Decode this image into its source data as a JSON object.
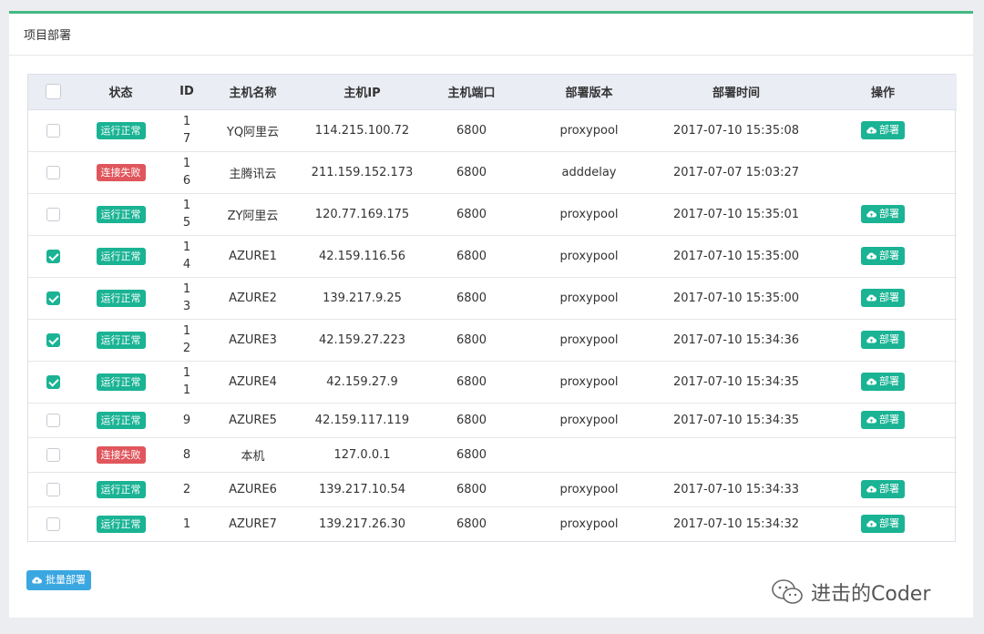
{
  "panel": {
    "title": "项目部署"
  },
  "table": {
    "headers": {
      "status": "状态",
      "id": "ID",
      "host_name": "主机名称",
      "host_ip": "主机IP",
      "host_port": "主机端口",
      "version": "部署版本",
      "time": "部署时间",
      "action": "操作"
    },
    "rows": [
      {
        "checked": false,
        "status": "运行正常",
        "status_type": "ok",
        "id_lines": [
          "1",
          "7"
        ],
        "name": "YQ阿里云",
        "ip": "114.215.100.72",
        "port": "6800",
        "version": "proxypool",
        "time": "2017-07-10 15:35:08",
        "action": "部署",
        "tall": true
      },
      {
        "checked": false,
        "status": "连接失败",
        "status_type": "fail",
        "id_lines": [
          "1",
          "6"
        ],
        "name": "主腾讯云",
        "ip": "211.159.152.173",
        "port": "6800",
        "version": "adddelay",
        "time": "2017-07-07 15:03:27",
        "action": "",
        "tall": true
      },
      {
        "checked": false,
        "status": "运行正常",
        "status_type": "ok",
        "id_lines": [
          "1",
          "5"
        ],
        "name": "ZY阿里云",
        "ip": "120.77.169.175",
        "port": "6800",
        "version": "proxypool",
        "time": "2017-07-10 15:35:01",
        "action": "部署",
        "tall": true
      },
      {
        "checked": true,
        "status": "运行正常",
        "status_type": "ok",
        "id_lines": [
          "1",
          "4"
        ],
        "name": "AZURE1",
        "ip": "42.159.116.56",
        "port": "6800",
        "version": "proxypool",
        "time": "2017-07-10 15:35:00",
        "action": "部署",
        "tall": true
      },
      {
        "checked": true,
        "status": "运行正常",
        "status_type": "ok",
        "id_lines": [
          "1",
          "3"
        ],
        "name": "AZURE2",
        "ip": "139.217.9.25",
        "port": "6800",
        "version": "proxypool",
        "time": "2017-07-10 15:35:00",
        "action": "部署",
        "tall": true
      },
      {
        "checked": true,
        "status": "运行正常",
        "status_type": "ok",
        "id_lines": [
          "1",
          "2"
        ],
        "name": "AZURE3",
        "ip": "42.159.27.223",
        "port": "6800",
        "version": "proxypool",
        "time": "2017-07-10 15:34:36",
        "action": "部署",
        "tall": true
      },
      {
        "checked": true,
        "status": "运行正常",
        "status_type": "ok",
        "id_lines": [
          "1",
          "1"
        ],
        "name": "AZURE4",
        "ip": "42.159.27.9",
        "port": "6800",
        "version": "proxypool",
        "time": "2017-07-10 15:34:35",
        "action": "部署",
        "tall": true
      },
      {
        "checked": false,
        "status": "运行正常",
        "status_type": "ok",
        "id_lines": [
          "9"
        ],
        "name": "AZURE5",
        "ip": "42.159.117.119",
        "port": "6800",
        "version": "proxypool",
        "time": "2017-07-10 15:34:35",
        "action": "部署",
        "tall": false
      },
      {
        "checked": false,
        "status": "连接失败",
        "status_type": "fail",
        "id_lines": [
          "8"
        ],
        "name": "本机",
        "ip": "127.0.0.1",
        "port": "6800",
        "version": "",
        "time": "",
        "action": "",
        "tall": false
      },
      {
        "checked": false,
        "status": "运行正常",
        "status_type": "ok",
        "id_lines": [
          "2"
        ],
        "name": "AZURE6",
        "ip": "139.217.10.54",
        "port": "6800",
        "version": "proxypool",
        "time": "2017-07-10 15:34:33",
        "action": "部署",
        "tall": false
      },
      {
        "checked": false,
        "status": "运行正常",
        "status_type": "ok",
        "id_lines": [
          "1"
        ],
        "name": "AZURE7",
        "ip": "139.217.26.30",
        "port": "6800",
        "version": "proxypool",
        "time": "2017-07-10 15:34:32",
        "action": "部署",
        "tall": false
      }
    ]
  },
  "batch_button": {
    "label": "批量部署",
    "icon": "cloud-upload-icon"
  },
  "watermark": {
    "text": "进击的Coder",
    "icon": "wechat-icon"
  },
  "colors": {
    "accent_top": "#42b983",
    "ok": "#1ab394",
    "fail": "#e0565c",
    "batch": "#3ba7e0",
    "header_bg": "#ebedf5"
  }
}
